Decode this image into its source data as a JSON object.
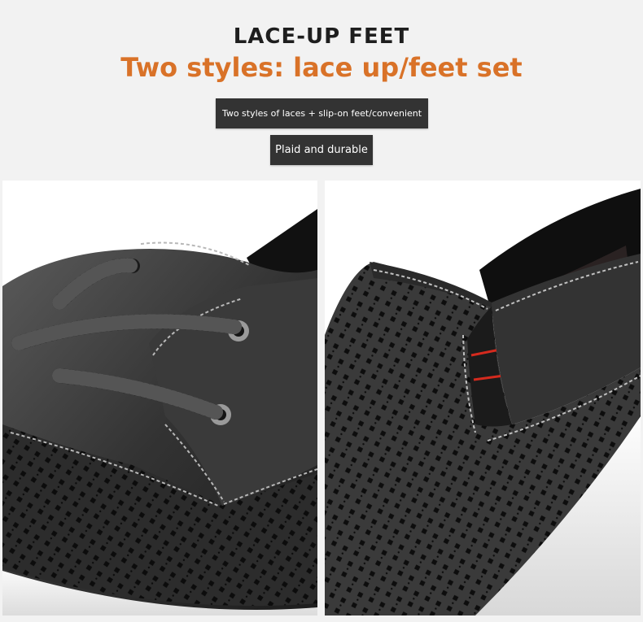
{
  "header": {
    "title": "LACE-UP FEET",
    "subtitle": "Two styles: lace up/feet set"
  },
  "tags": {
    "primary": "Two styles of laces + slip-on feet/convenient",
    "secondary": "Plaid and durable"
  },
  "photos": {
    "left": {
      "subject": "lace-up black perforated leather shoe"
    },
    "right": {
      "subject": "slip-on black perforated leather shoe with elastic gusset"
    }
  },
  "colors": {
    "subtitle_orange": "#d97228",
    "tag_bg": "#333333",
    "page_bg": "#f2f2f2",
    "gusset_red": "#d42a1e"
  }
}
